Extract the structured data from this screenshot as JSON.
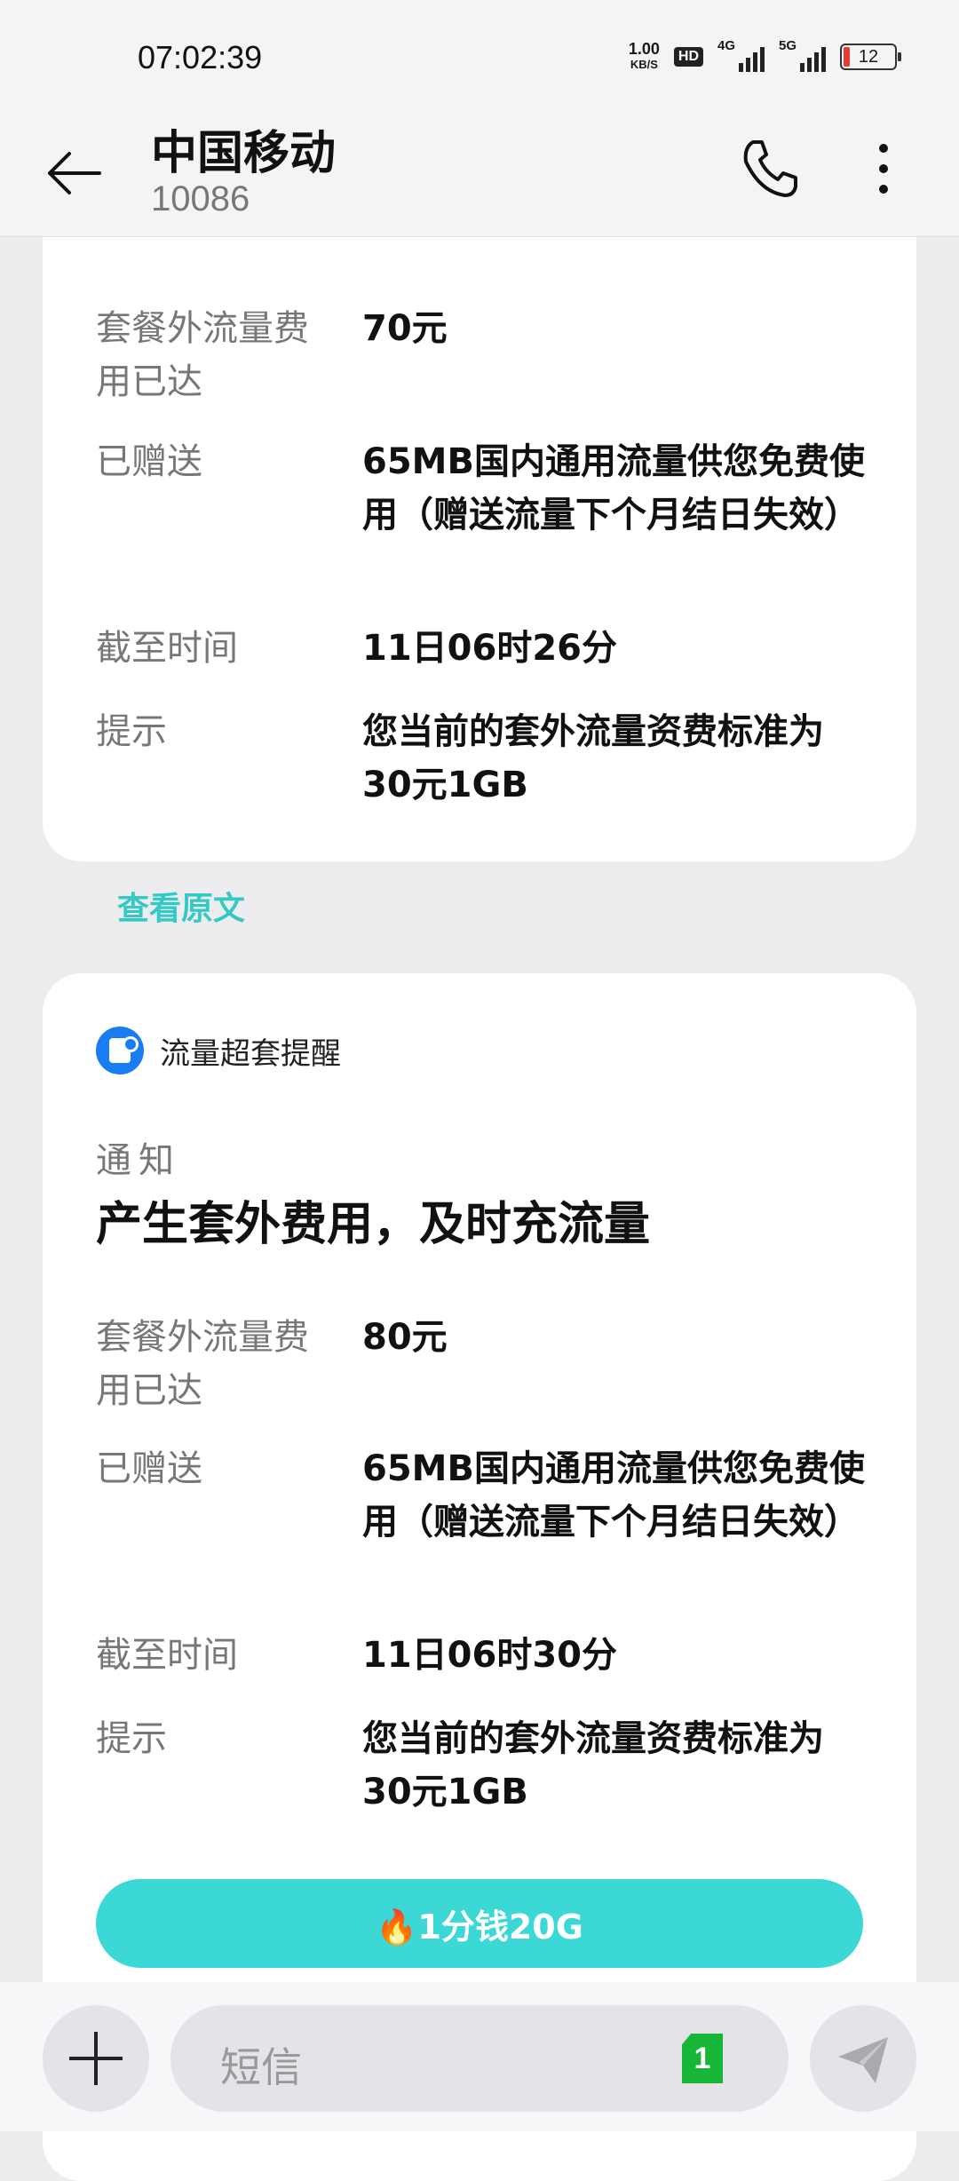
{
  "status_bar": {
    "time": "07:02:39",
    "net_speed_value": "1.00",
    "net_speed_unit": "KB/S",
    "hd_badge": "HD",
    "sim1_label": "4G",
    "sim2_label": "5G",
    "battery": "12"
  },
  "header": {
    "title": "中国移动",
    "subtitle": "10086",
    "icons": [
      "back-arrow-icon",
      "phone-icon",
      "more-icon"
    ]
  },
  "messages": [
    {
      "rows": [
        {
          "key": "套餐外流量费用已达",
          "value": "70元"
        },
        {
          "key": "已赠送",
          "value": "65MB国内通用流量供您免费使用（赠送流量下个月结日失效）"
        },
        {
          "key": "截至时间",
          "value": "11日06时26分"
        },
        {
          "key": "提示",
          "value": "您当前的套外流量资费标准为30元1GB"
        }
      ],
      "view_original": "查看原文"
    },
    {
      "tag": "流量超套提醒",
      "notice_label": "通知",
      "notice_title": "产生套外费用，及时充流量",
      "rows": [
        {
          "key": "套餐外流量费用已达",
          "value": "80元"
        },
        {
          "key": "已赠送",
          "value": "65MB国内通用流量供您免费使用（赠送流量下个月结日失效）"
        },
        {
          "key": "截至时间",
          "value": "11日06时30分"
        },
        {
          "key": "提示",
          "value": "您当前的套外流量资费标准为30元1GB"
        }
      ],
      "cta": "🔥1分钱20G"
    }
  ],
  "composer": {
    "placeholder": "短信",
    "sim_badge": "1",
    "icons": [
      "plus-icon",
      "send-icon"
    ]
  },
  "colors": {
    "accent": "#3bd8d6",
    "link": "#35c9c6",
    "tag_icon": "#1a7cf2",
    "sim_badge": "#17b637",
    "background": "#ededef"
  }
}
